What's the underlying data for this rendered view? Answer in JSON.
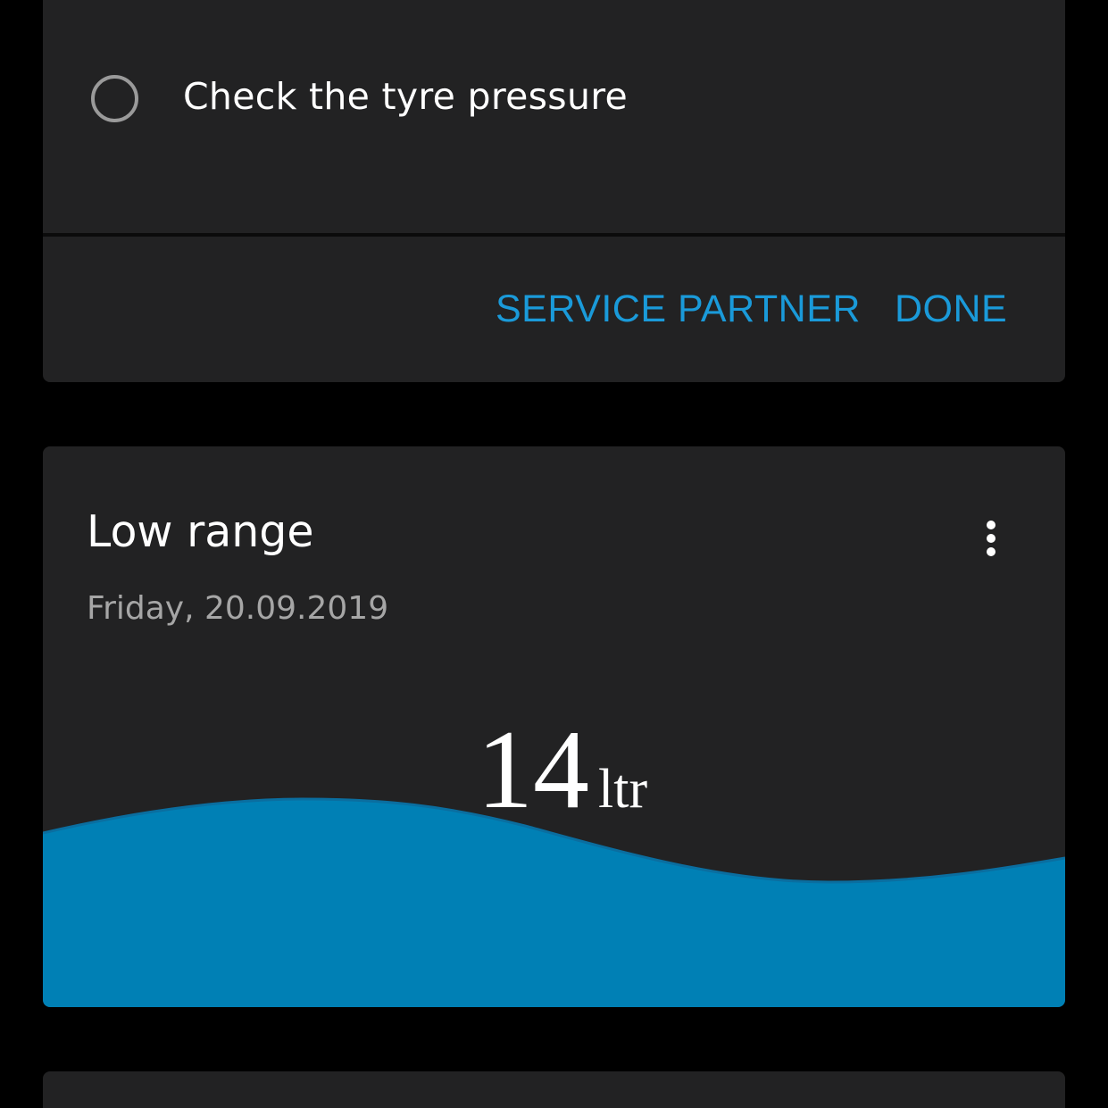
{
  "checklist": {
    "item_label": "Check the tyre pressure"
  },
  "actions": {
    "service_partner_label": "SERVICE PARTNER",
    "done_label": "DONE"
  },
  "range_card": {
    "title": "Low range",
    "date": "Friday, 20.09.2019",
    "value": "14",
    "unit": "ltr"
  },
  "colors": {
    "background": "#000000",
    "card": "#222223",
    "accent": "#1a9ad9",
    "wave_fill": "#0080b5"
  },
  "icons": {
    "radio": "radio-unchecked-icon",
    "more": "more-vertical-icon"
  }
}
